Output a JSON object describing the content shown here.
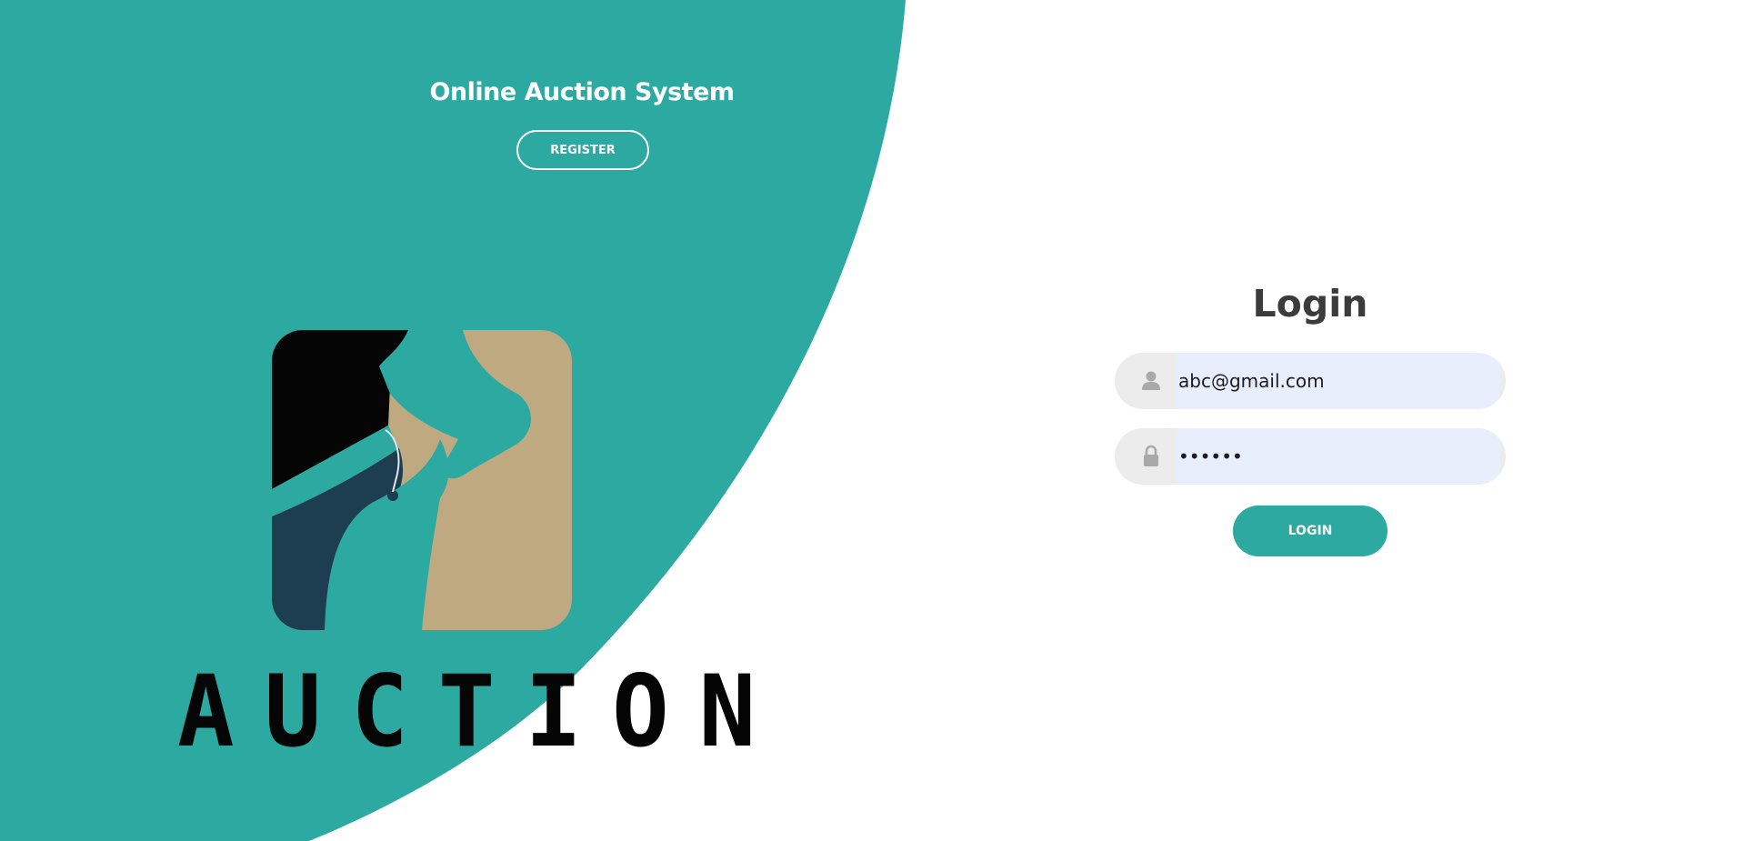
{
  "colors": {
    "accent": "#2ca9a1",
    "heading_text": "#3b3b3b",
    "field_bg": "#ececec",
    "input_autofill_bg": "#e8eefb",
    "icon_gray": "#a9a9a9",
    "logo_black": "#050505",
    "logo_navy": "#1d3e50",
    "logo_tan": "#bfa981"
  },
  "header": {
    "title": "Online Auction System",
    "register_label": "REGISTER"
  },
  "logo": {
    "text": "AUCTION",
    "icon": "gavel-hand-icon"
  },
  "login": {
    "heading": "Login",
    "email": {
      "icon": "user-icon",
      "value": "abc@gmail.com"
    },
    "password": {
      "icon": "lock-icon",
      "value": "••••••"
    },
    "button_label": "LOGIN"
  }
}
